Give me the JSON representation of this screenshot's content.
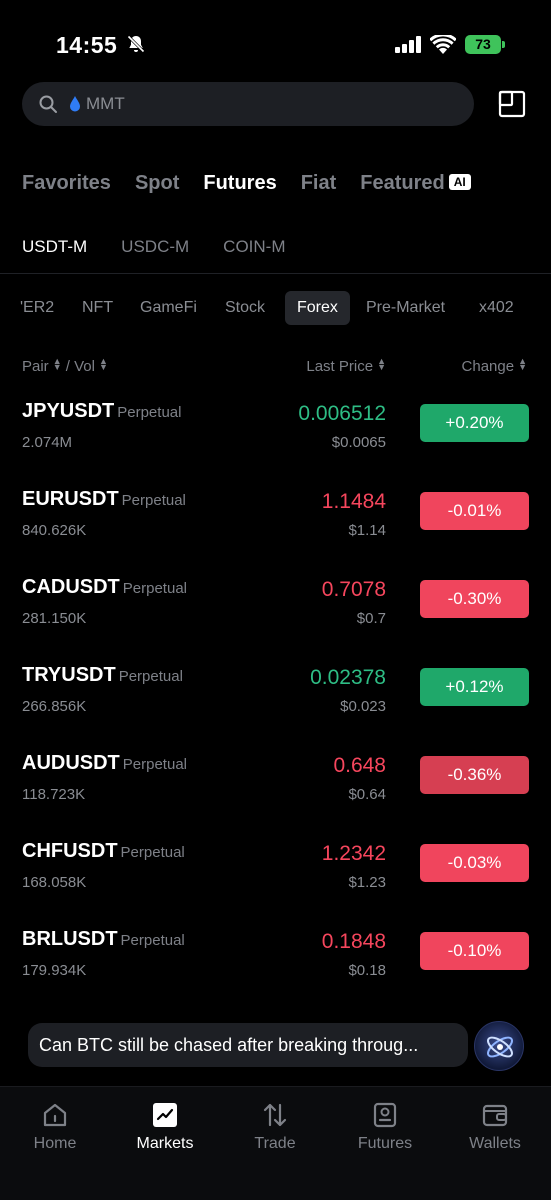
{
  "status_bar": {
    "time": "14:55",
    "battery": "73"
  },
  "search": {
    "placeholder": "MMT"
  },
  "main_tabs": [
    "Favorites",
    "Spot",
    "Futures",
    "Fiat",
    "Featured"
  ],
  "featured_badge": "AI",
  "margin_tabs": [
    "USDT-M",
    "USDC-M",
    "COIN-M"
  ],
  "categories": [
    "'ER2",
    "NFT",
    "GameFi",
    "Stock",
    "Forex",
    "Pre-Market",
    "x402"
  ],
  "columns": {
    "pair": "Pair",
    "vol": "/ Vol",
    "last_price": "Last Price",
    "change": "Change"
  },
  "rows": [
    {
      "pair": "JPYUSDT",
      "type": "Perpetual",
      "vol": "2.074M",
      "price": "0.006512",
      "usd": "$0.0065",
      "change": "+0.20%",
      "direction": "up"
    },
    {
      "pair": "EURUSDT",
      "type": "Perpetual",
      "vol": "840.626K",
      "price": "1.1484",
      "usd": "$1.14",
      "change": "-0.01%",
      "direction": "down"
    },
    {
      "pair": "CADUSDT",
      "type": "Perpetual",
      "vol": "281.150K",
      "price": "0.7078",
      "usd": "$0.7",
      "change": "-0.30%",
      "direction": "down"
    },
    {
      "pair": "TRYUSDT",
      "type": "Perpetual",
      "vol": "266.856K",
      "price": "0.02378",
      "usd": "$0.023",
      "change": "+0.12%",
      "direction": "up"
    },
    {
      "pair": "AUDUSDT",
      "type": "Perpetual",
      "vol": "118.723K",
      "price": "0.648",
      "usd": "$0.64",
      "change": "-0.36%",
      "direction": "down"
    },
    {
      "pair": "CHFUSDT",
      "type": "Perpetual",
      "vol": "168.058K",
      "price": "1.2342",
      "usd": "$1.23",
      "change": "-0.03%",
      "direction": "down"
    },
    {
      "pair": "BRLUSDT",
      "type": "Perpetual",
      "vol": "179.934K",
      "price": "0.1848",
      "usd": "$0.18",
      "change": "-0.10%",
      "direction": "down"
    }
  ],
  "ai_prompt": "Can BTC still be chased after breaking throug...",
  "nav": [
    "Home",
    "Markets",
    "Trade",
    "Futures",
    "Wallets"
  ],
  "colors": {
    "up": "#2ebd85",
    "down": "#f6465d",
    "background": "#000000"
  }
}
